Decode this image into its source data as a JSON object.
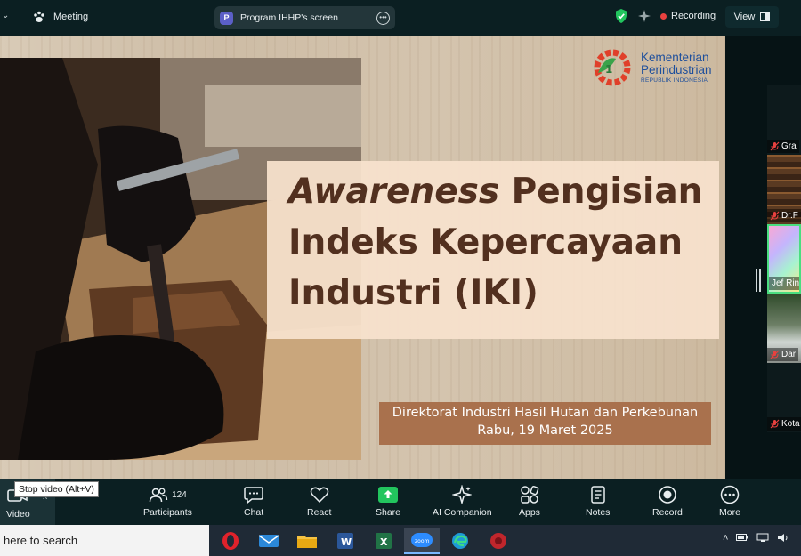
{
  "topbar": {
    "meeting_label": "Meeting",
    "share_badge": "P",
    "share_label": "Program IHHP's screen",
    "recording_label": "Recording",
    "view_label": "View"
  },
  "slide": {
    "logo_line1": "Kementerian",
    "logo_line2": "Perindustrian",
    "logo_sub": "REPUBLIK INDONESIA",
    "title_em": "Awareness",
    "title_rest1": " Pengisian",
    "title_line2": "Indeks Kepercayaan",
    "title_line3": "Industri (IKI)",
    "sub_line1": "Direktorat Industri Hasil Hutan dan Perkebunan",
    "sub_line2": "Rabu, 19 Maret 2025"
  },
  "participants": [
    {
      "name": "Gra",
      "muted": true
    },
    {
      "name": "Dr.F",
      "muted": true
    },
    {
      "name": "Jef Rin",
      "muted": false
    },
    {
      "name": "Dar",
      "muted": true
    },
    {
      "name": "Kota",
      "muted": true
    }
  ],
  "toolbar": {
    "video_label": "Video",
    "tooltip": "Stop video (Alt+V)",
    "participants_label": "Participants",
    "participants_count": "124",
    "chat_label": "Chat",
    "react_label": "React",
    "share_label": "Share",
    "ai_label": "AI Companion",
    "apps_label": "Apps",
    "notes_label": "Notes",
    "record_label": "Record",
    "more_label": "More"
  },
  "taskbar": {
    "search_text": "here to search",
    "apps": [
      "opera-icon",
      "mail-icon",
      "file-explorer-icon",
      "word-icon",
      "excel-icon",
      "zoom-icon",
      "edge-icon",
      "app-icon"
    ]
  },
  "colors": {
    "zoom_bg": "#0b1f22",
    "title_brown": "#52301f",
    "subtitle_box": "#a9714d",
    "recording_red": "#e8413f",
    "share_green": "#22c55e"
  }
}
